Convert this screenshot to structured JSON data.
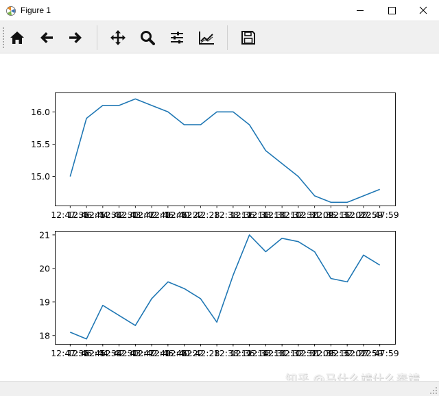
{
  "window": {
    "title": "Figure 1",
    "controls": [
      "minimize",
      "maximize",
      "close"
    ]
  },
  "toolbar": {
    "buttons": [
      {
        "name": "home-button",
        "icon": "home-icon"
      },
      {
        "name": "back-button",
        "icon": "arrow-left-icon"
      },
      {
        "name": "forward-button",
        "icon": "arrow-right-icon"
      },
      {
        "name": "pan-button",
        "icon": "move-icon"
      },
      {
        "name": "zoom-button",
        "icon": "magnifier-icon"
      },
      {
        "name": "subplots-button",
        "icon": "sliders-icon"
      },
      {
        "name": "edit-axes-button",
        "icon": "line-chart-icon"
      },
      {
        "name": "save-button",
        "icon": "floppy-disk-icon"
      }
    ]
  },
  "watermark": "知乎 @马什么靖什么秦靖",
  "chart_data": [
    {
      "type": "line",
      "color": "#1f77b4",
      "categories": [
        "12:47:36",
        "12:46:45",
        "12:44:34",
        "12:42:30",
        "12:43:47",
        "12:42:40",
        "12:46:46",
        "12:40:22",
        "12:42:28",
        "12:38:12",
        "12:36:14",
        "12:33:13",
        "12:31:10",
        "12:32:32",
        "12:31:09",
        "12:35:15",
        "12:32:02",
        "12:27:59"
      ],
      "tick_labels_visible": [
        true,
        true,
        true,
        true,
        true,
        true,
        true,
        true,
        true,
        true,
        true,
        true,
        true,
        true,
        true,
        true,
        true,
        false
      ],
      "last_tick_label_visible": "12:47:59",
      "values": [
        15.0,
        15.9,
        16.1,
        16.1,
        16.2,
        16.1,
        16.0,
        15.8,
        15.8,
        16.0,
        16.0,
        15.8,
        15.4,
        15.2,
        15.0,
        14.7,
        14.6,
        14.6,
        14.7,
        14.8
      ],
      "x_index": [
        0,
        1,
        2,
        3,
        4,
        5,
        6,
        7,
        8,
        9,
        10,
        11,
        12,
        13,
        14,
        15,
        16,
        17,
        18,
        19
      ],
      "ylim": [
        14.55,
        16.3
      ],
      "yticks": [
        15.0,
        15.5,
        16.0
      ],
      "ytick_labels": [
        "15.0",
        "15.5",
        "16.0"
      ],
      "title": "",
      "xlabel": "",
      "ylabel": "",
      "grid": false,
      "legend": "none"
    },
    {
      "type": "line",
      "color": "#1f77b4",
      "categories": [
        "12:47:36",
        "12:46:45",
        "12:44:34",
        "12:42:30",
        "12:43:47",
        "12:42:40",
        "12:46:46",
        "12:40:22",
        "12:42:28",
        "12:38:12",
        "12:36:14",
        "12:33:13",
        "12:31:10",
        "12:32:32",
        "12:31:09",
        "12:35:15",
        "12:32:02",
        "12:27:59"
      ],
      "last_tick_label_visible": "12:47:59",
      "values": [
        18.1,
        17.9,
        18.9,
        18.6,
        18.3,
        19.1,
        19.6,
        19.4,
        19.1,
        18.4,
        19.8,
        21.0,
        20.5,
        20.9,
        20.8,
        20.5,
        19.7,
        19.6,
        20.4,
        20.1
      ],
      "x_index": [
        0,
        1,
        2,
        3,
        4,
        5,
        6,
        7,
        8,
        9,
        10,
        11,
        12,
        13,
        14,
        15,
        16,
        17,
        18,
        19
      ],
      "ylim": [
        17.75,
        21.12
      ],
      "yticks": [
        18,
        19,
        20,
        21
      ],
      "ytick_labels": [
        "18",
        "19",
        "20",
        "21"
      ],
      "title": "",
      "xlabel": "",
      "ylabel": "",
      "grid": false,
      "legend": "none"
    }
  ]
}
